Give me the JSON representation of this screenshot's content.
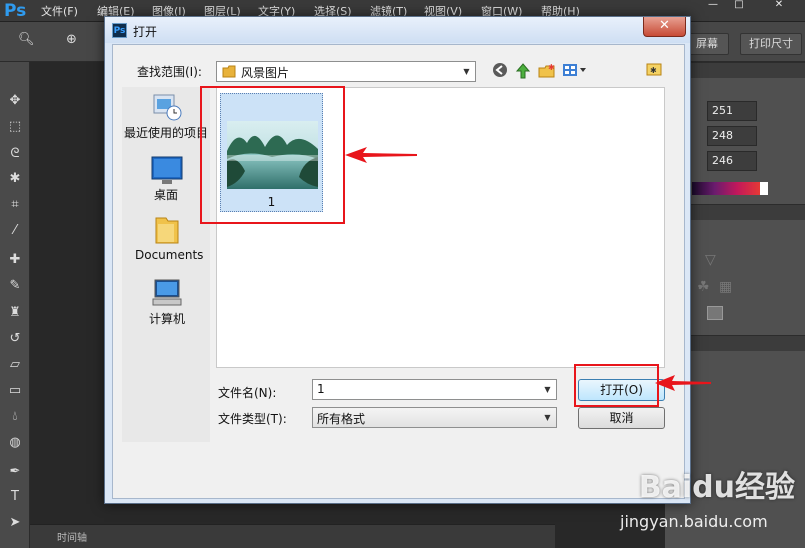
{
  "ps": {
    "logo": "Ps",
    "menu": [
      "文件(F)",
      "编辑(E)",
      "图像(I)",
      "图层(L)",
      "文字(Y)",
      "选择(S)",
      "滤镜(T)",
      "视图(V)",
      "窗口(W)",
      "帮助(H)"
    ],
    "options": {
      "screen_btn": "屏幕",
      "print_size_btn": "打印尺寸"
    },
    "color_values": {
      "r": "251",
      "g": "248",
      "b": "246"
    },
    "timeline_label": "时间轴"
  },
  "dialog": {
    "title": "打开",
    "look_in_label": "查找范围(I):",
    "look_in_value": "风景图片",
    "places": [
      "最近使用的项目",
      "桌面",
      "Documents",
      "计算机"
    ],
    "files": [
      {
        "name": "1"
      }
    ],
    "filename_label": "文件名(N):",
    "filename_value": "1",
    "filetype_label": "文件类型(T):",
    "filetype_value": "所有格式",
    "open_btn": "打开(O)",
    "cancel_btn": "取消"
  },
  "watermark": {
    "brand": "Baidu经验",
    "url": "jingyan.baidu.com"
  },
  "colors": {
    "highlight": "#e8151b",
    "selection": "#cce2f7",
    "ps_blue": "#2f9bef"
  }
}
